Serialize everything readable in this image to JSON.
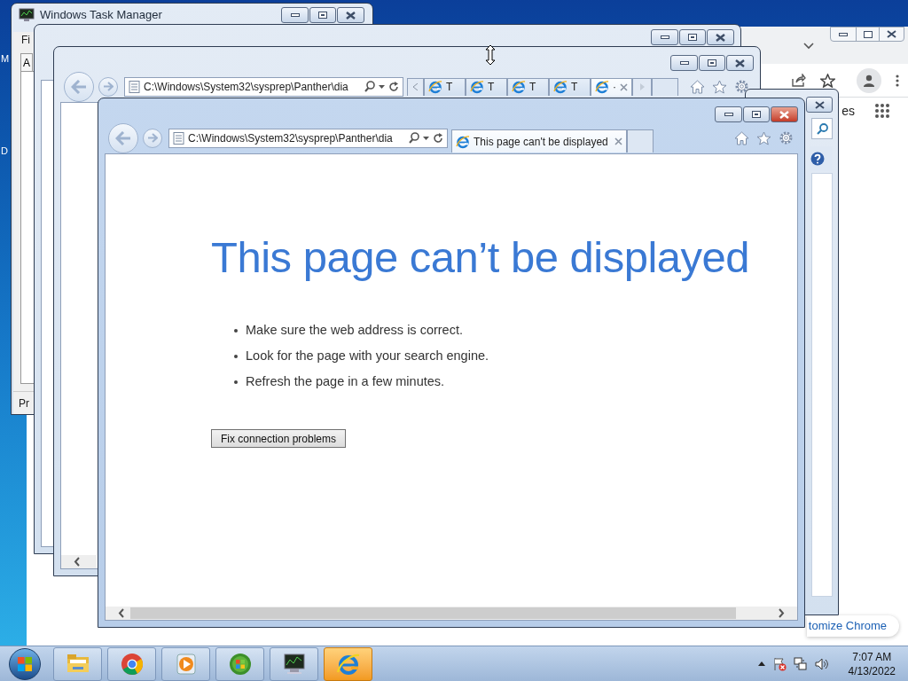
{
  "desktop": {
    "icon_labels": [
      "M",
      "D"
    ]
  },
  "chrome": {
    "partial_link": "es",
    "customize_button": "tomize Chrome"
  },
  "task_manager": {
    "title": "Windows Task Manager",
    "menu_item": "Fi",
    "tab": "A",
    "status_bar": "Pr",
    "active": false
  },
  "back_browser": {
    "active": false
  },
  "middle_browser": {
    "active": false,
    "address": "C:\\Windows\\System32\\sysprep\\Panther\\dia",
    "tabs": [
      {
        "label": "T",
        "selected": false
      },
      {
        "label": "T",
        "selected": false
      },
      {
        "label": "T",
        "selected": false
      },
      {
        "label": "T",
        "selected": false
      },
      {
        "label": "·",
        "selected": true
      }
    ]
  },
  "browser": {
    "active": true,
    "address": "C:\\Windows\\System32\\sysprep\\Panther\\dia",
    "tabs": [
      {
        "label": "This page can't be displayed",
        "selected": true
      }
    ],
    "page": {
      "heading": "This page can’t be displayed",
      "tips": [
        "Make sure the web address is correct.",
        "Look for the page with your search engine.",
        "Refresh the page in a few minutes."
      ],
      "button": "Fix connection problems"
    }
  },
  "taskbar": {
    "items": [
      {
        "kind": "explorer",
        "selected": false
      },
      {
        "kind": "chrome",
        "selected": false
      },
      {
        "kind": "media",
        "selected": false
      },
      {
        "kind": "media_center",
        "selected": false
      },
      {
        "kind": "task_manager",
        "selected": false
      },
      {
        "kind": "ie",
        "selected": true
      }
    ],
    "clock": {
      "time": "7:07 AM",
      "date": "4/13/2022"
    }
  }
}
